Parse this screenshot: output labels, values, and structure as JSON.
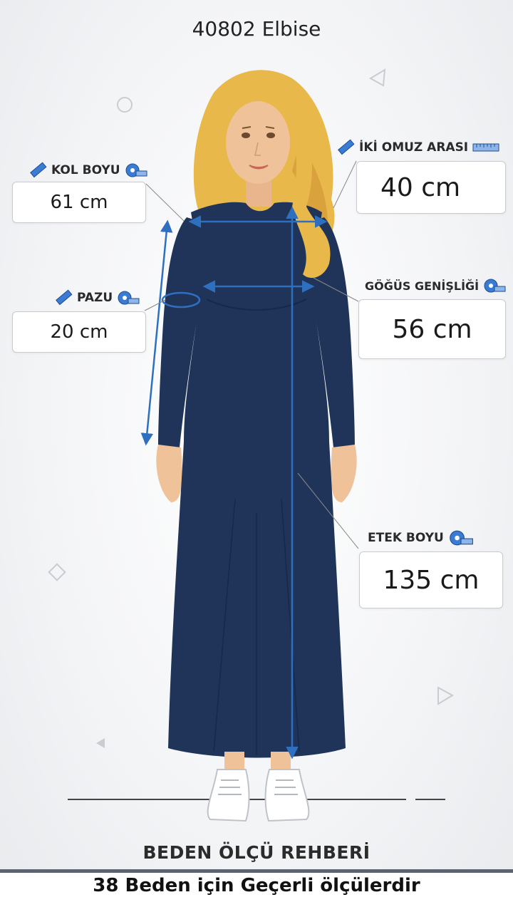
{
  "product": {
    "title": "40802 Elbise"
  },
  "measurements": {
    "kol_boyu": {
      "label": "KOL BOYU",
      "value": "61 cm"
    },
    "iki_omuz_arasi": {
      "label": "İKİ OMUZ ARASI",
      "value": "40 cm"
    },
    "pazu": {
      "label": "PAZU",
      "value": "20 cm"
    },
    "gogus_genisligi": {
      "label": "GÖĞÜS GENİŞLİĞİ",
      "value": "56 cm"
    },
    "etek_boyu": {
      "label": "ETEK BOYU",
      "value": "135 cm"
    }
  },
  "footer": {
    "guide_title": "BEDEN ÖLÇÜ REHBERİ",
    "note": "38 Beden için Geçerli ölçülerdir"
  },
  "colors": {
    "dress": "#1f3458",
    "arrow": "#2f6fc0",
    "hair": "#e8b84a",
    "skin": "#f0c29a"
  },
  "icons": [
    "ruler-icon",
    "tape-measure-icon"
  ]
}
